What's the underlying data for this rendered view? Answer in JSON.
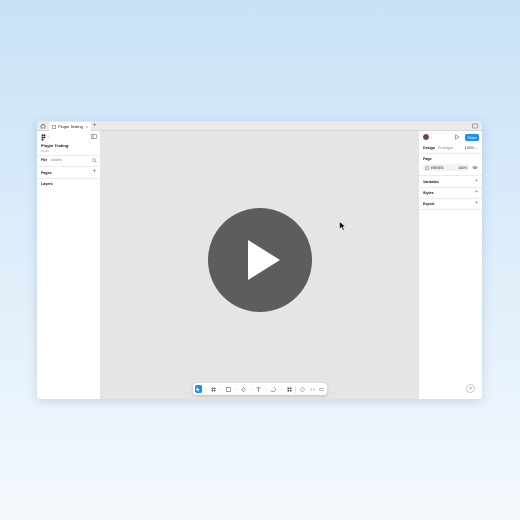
{
  "tabs": [
    {
      "label": "Plugin Testing",
      "close": "×"
    }
  ],
  "tab_add": "+",
  "left_panel": {
    "caret": "⌄",
    "file_name": "Plugin Testing",
    "file_caret": "⌄",
    "plan": "Drafts",
    "file_tab": "File",
    "assets_tab": "Assets",
    "pages_label": "Pages",
    "add_page": "+",
    "layers_label": "Layers"
  },
  "right_panel": {
    "avatar_caret": "⌄",
    "share": "Share",
    "design_tab": "Design",
    "prototype_tab": "Prototype",
    "zoom": "100% ⌄",
    "page_label": "Page",
    "background_hex": "E5E5E5",
    "background_opacity": "100%",
    "sections": [
      {
        "label": "Variables",
        "add": "+"
      },
      {
        "label": "Styles",
        "add": "+"
      },
      {
        "label": "Export",
        "add": "+"
      }
    ]
  },
  "toolbar": {
    "caret": "⌄"
  },
  "help": "?",
  "colors": {
    "accent": "#1e90e6",
    "canvas": "#e5e5e5",
    "play_overlay": "#5d5d5d"
  }
}
